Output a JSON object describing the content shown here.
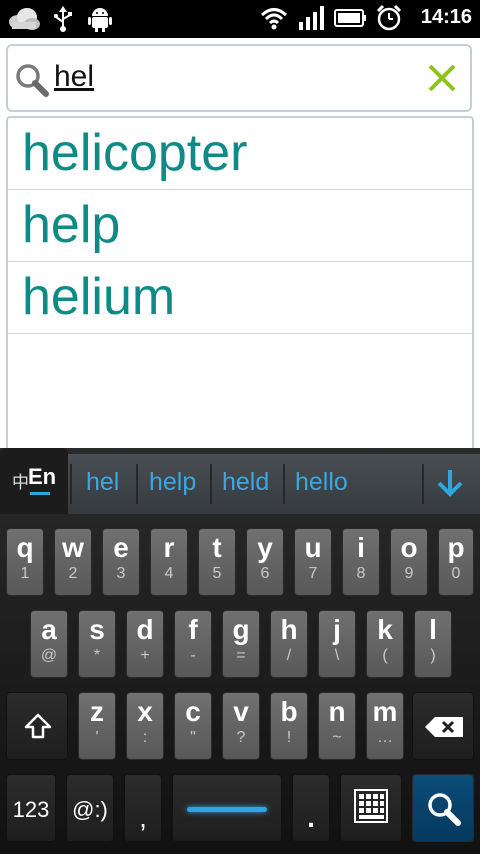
{
  "status_bar": {
    "time": "14:16",
    "left_icons": [
      "cloud-icon",
      "usb-icon",
      "android-icon"
    ],
    "right_icons": [
      "wifi-icon",
      "signal-icon",
      "battery-icon",
      "alarm-clock-icon"
    ]
  },
  "search": {
    "query": "hel",
    "icon": "search-icon",
    "clear_icon": "close-icon",
    "clear_color": "#8cc518"
  },
  "suggestions": [
    "helicopter",
    "help",
    "helium"
  ],
  "keyboard": {
    "lang_label_cn": "中",
    "lang_label_en": "En",
    "candidates": [
      "hel",
      "help",
      "held",
      "hello"
    ],
    "collapse_icon": "arrow-down-icon",
    "rows": [
      [
        {
          "main": "q",
          "sub": "1"
        },
        {
          "main": "w",
          "sub": "2"
        },
        {
          "main": "e",
          "sub": "3"
        },
        {
          "main": "r",
          "sub": "4"
        },
        {
          "main": "t",
          "sub": "5"
        },
        {
          "main": "y",
          "sub": "6"
        },
        {
          "main": "u",
          "sub": "7"
        },
        {
          "main": "i",
          "sub": "8"
        },
        {
          "main": "o",
          "sub": "9"
        },
        {
          "main": "p",
          "sub": "0"
        }
      ],
      [
        {
          "main": "a",
          "sub": "@"
        },
        {
          "main": "s",
          "sub": "*"
        },
        {
          "main": "d",
          "sub": "+"
        },
        {
          "main": "f",
          "sub": "-"
        },
        {
          "main": "g",
          "sub": "="
        },
        {
          "main": "h",
          "sub": "/"
        },
        {
          "main": "j",
          "sub": "\\"
        },
        {
          "main": "k",
          "sub": "("
        },
        {
          "main": "l",
          "sub": ")"
        }
      ],
      [
        {
          "main": "z",
          "sub": "'"
        },
        {
          "main": "x",
          "sub": ":"
        },
        {
          "main": "c",
          "sub": "\""
        },
        {
          "main": "v",
          "sub": "?"
        },
        {
          "main": "b",
          "sub": "!"
        },
        {
          "main": "n",
          "sub": "~"
        },
        {
          "main": "m",
          "sub": "…"
        }
      ]
    ],
    "shift_icon": "shift-icon",
    "backspace_icon": "backspace-icon",
    "key_123": "123",
    "key_emoticon": "@:)",
    "key_comma": ",",
    "key_period": ".",
    "keyboard_switch_icon": "keyboard-grid-icon",
    "search_key_icon": "search-icon",
    "accent": "#2ea6e0",
    "suggestion_color": "#0e8a87"
  }
}
